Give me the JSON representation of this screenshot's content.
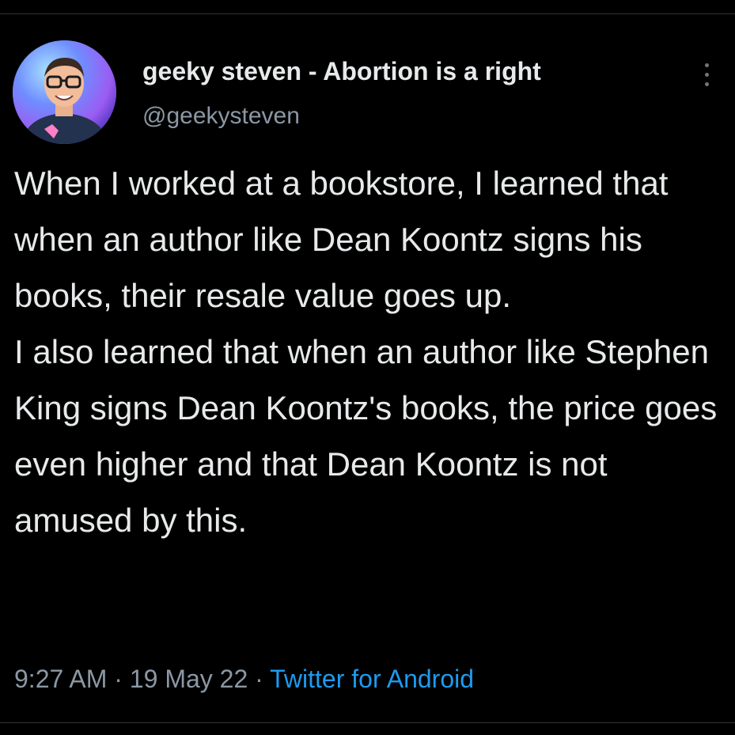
{
  "author": {
    "display_name": "geeky steven - Abortion is a right",
    "handle": "@geekysteven"
  },
  "tweet": {
    "paragraphs": [
      "When I worked at a bookstore, I learned that when an author like Dean Koontz signs his books, their resale value goes up.",
      "I also learned that when an author like Stephen King signs Dean Koontz's books, the price goes even higher and that Dean Koontz is not amused by this."
    ]
  },
  "meta": {
    "time": "9:27 AM",
    "separator": "·",
    "date": "19 May 22",
    "source": "Twitter for Android"
  },
  "icons": {
    "more": "more-vertical-icon"
  },
  "colors": {
    "background": "#000000",
    "text": "#e7e9ea",
    "secondary": "#8b98a5",
    "link": "#1d9bf0"
  }
}
